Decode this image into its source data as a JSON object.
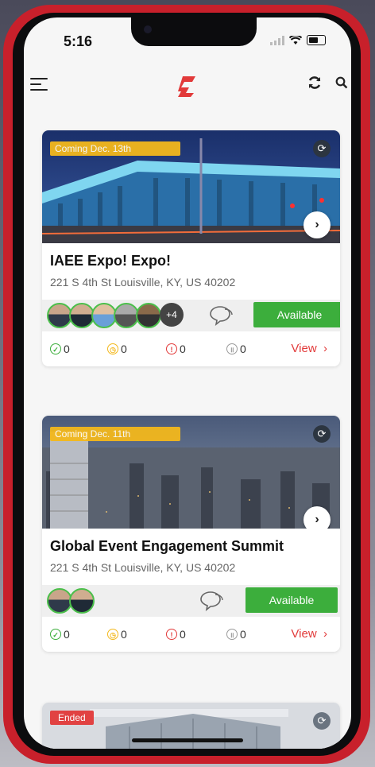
{
  "status_bar": {
    "time": "5:16"
  },
  "events": [
    {
      "badge": "Coming Dec. 13th",
      "title": "IAEE Expo! Expo!",
      "address": "221 S 4th St Louisville, KY, US 40202",
      "more_count": "+4",
      "action_label": "Available",
      "stats": {
        "completed": "0",
        "pending": "0",
        "alert": "0",
        "paused": "0"
      },
      "view_label": "View",
      "view_chevron": "›"
    },
    {
      "badge": "Coming Dec. 11th",
      "title": "Global Event Engagement Summit",
      "address": "221 S 4th St Louisville, KY, US 40202",
      "action_label": "Available",
      "stats": {
        "completed": "0",
        "pending": "0",
        "alert": "0",
        "paused": "0"
      },
      "view_label": "View",
      "view_chevron": "›"
    },
    {
      "badge": "Ended"
    }
  ],
  "colors": {
    "brand_red": "#e23a3a",
    "coming_badge": "#f3b81c",
    "available_green": "#3cae3c",
    "check_green": "#3cae3c",
    "pending_yellow": "#f3b81c",
    "alert_red": "#e23a3a",
    "paused_gray": "#9a9a9a"
  },
  "icons": {
    "menu": "menu-icon",
    "logo": "brand-logo-icon",
    "refresh": "refresh-icon",
    "search": "search-icon",
    "sync": "sync-icon",
    "next": "chevron-right-icon",
    "chat": "chat-bubbles-icon"
  }
}
